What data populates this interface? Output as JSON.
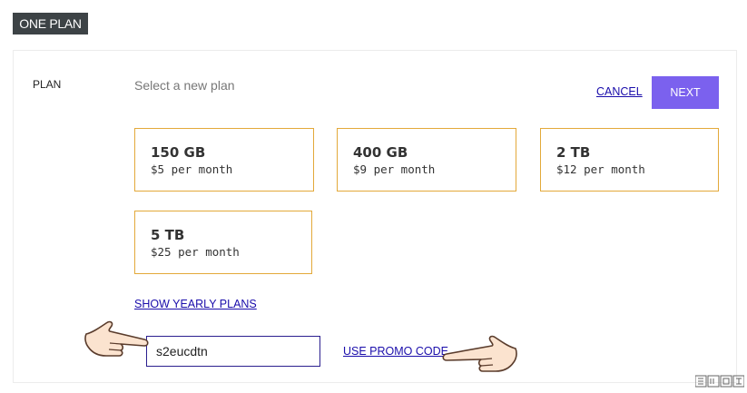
{
  "header": {
    "title": "ONE PLAN"
  },
  "plan_section": {
    "label": "PLAN",
    "subtitle": "Select a new plan",
    "cancel_label": "CANCEL",
    "next_label": "NEXT"
  },
  "plans": [
    {
      "size": "150 GB",
      "price": "$5 per month"
    },
    {
      "size": "400 GB",
      "price": "$9 per month"
    },
    {
      "size": "2 TB",
      "price": "$12 per month"
    },
    {
      "size": "5 TB",
      "price": "$25 per month"
    }
  ],
  "yearly_link": "SHOW YEARLY PLANS",
  "promo": {
    "value": "s2eucdtn",
    "link_label": "USE PROMO CODE"
  },
  "colors": {
    "accent": "#7b61ee",
    "card_border": "#e3a93a",
    "link": "#1a0dab",
    "header_bg": "#3d4346"
  },
  "icons": [
    "pointing-hand-right-icon",
    "pointing-hand-left-icon"
  ]
}
